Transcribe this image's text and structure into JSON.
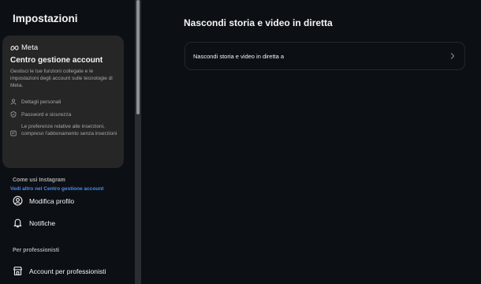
{
  "sidebar": {
    "title": "Impostazioni",
    "meta_card": {
      "brand": "Meta",
      "title": "Centro gestione account",
      "description": "Gestisci le tue funzioni collegate e le impostazioni degli account sulle tecnologie di Meta.",
      "items": [
        {
          "icon": "person-icon",
          "label": "Dettagli personali"
        },
        {
          "icon": "shield-icon",
          "label": "Password e sicurezza"
        },
        {
          "icon": "ad-icon",
          "label": "Le preferenze relative alle inserzioni, compreso l'abbonamento senza inserzioni"
        }
      ],
      "link": "Vedi altro nel Centro gestione account"
    },
    "section_instagram": "Come usi Instagram",
    "nav_items": [
      {
        "icon": "profile-icon",
        "label": "Modifica profilo"
      },
      {
        "icon": "bell-icon",
        "label": "Notifiche"
      }
    ],
    "section_pro": "Per professionisti",
    "pro_items": [
      {
        "icon": "shop-icon",
        "label": "Account per professionisti"
      }
    ]
  },
  "main": {
    "title": "Nascondi storia e video in diretta",
    "option": {
      "label": "Nascondi storia e video in diretta a",
      "icon": "chevron-right-icon"
    }
  },
  "colors": {
    "background": "#0c1014",
    "card": "#262626",
    "link": "#4a8af0",
    "muted_text": "#a8a8a8"
  }
}
